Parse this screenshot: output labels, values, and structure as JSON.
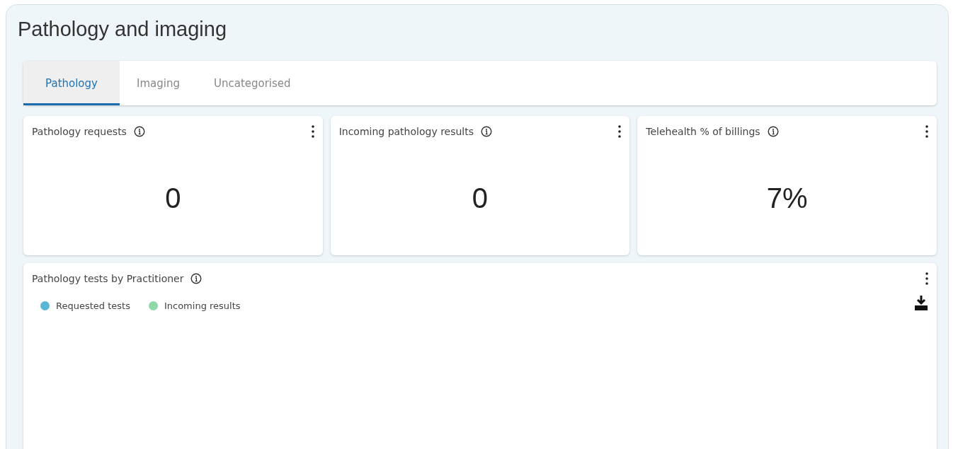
{
  "title": "Pathology and imaging",
  "tabs": [
    {
      "label": "Pathology",
      "selected": true
    },
    {
      "label": "Imaging",
      "selected": false
    },
    {
      "label": "Uncategorised",
      "selected": false
    }
  ],
  "metric_cards": [
    {
      "title": "Pathology requests",
      "value": "0"
    },
    {
      "title": "Incoming pathology results",
      "value": "0"
    },
    {
      "title": "Telehealth % of billings",
      "value": "7%"
    }
  ],
  "chart_card": {
    "title": "Pathology tests by Practitioner",
    "legend": [
      {
        "label": "Requested tests",
        "color": "#5ab6d6"
      },
      {
        "label": "Incoming results",
        "color": "#8ed9a8"
      }
    ]
  }
}
